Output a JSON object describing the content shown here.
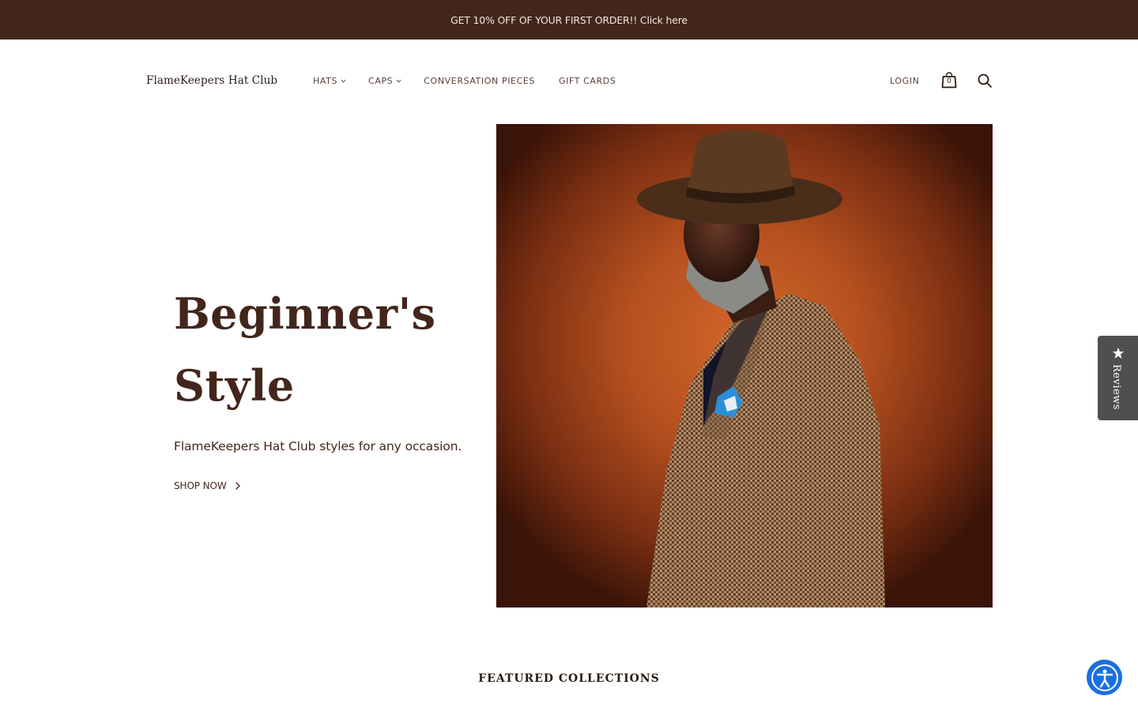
{
  "announcement": {
    "text": "GET 10% OFF OF YOUR FIRST ORDER!! Click here"
  },
  "header": {
    "logo": "FlameKeepers Hat Club",
    "nav": [
      {
        "label": "HATS",
        "has_dropdown": true
      },
      {
        "label": "CAPS",
        "has_dropdown": true
      },
      {
        "label": "CONVERSATION PIECES",
        "has_dropdown": false
      },
      {
        "label": "GIFT CARDS",
        "has_dropdown": false
      }
    ],
    "login": "LOGIN",
    "cart_count": "0"
  },
  "hero": {
    "title_line1": "Beginner's",
    "title_line2": "Style",
    "subtitle": "FlameKeepers Hat Club styles for any occasion.",
    "cta": "SHOP NOW"
  },
  "reviews_tab": {
    "label": "Reviews"
  },
  "featured": {
    "title": "FEATURED COLLECTIONS"
  },
  "colors": {
    "brand_brown": "#43261b",
    "a11y_blue": "#1a6fe0",
    "reviews_gray": "#4f4f4f"
  },
  "icons": {
    "cart": "shopping-bag-icon",
    "search": "search-icon",
    "chevron": "chevron-down-icon",
    "arrow": "chevron-right-icon",
    "star": "star-icon",
    "accessibility": "accessibility-icon"
  }
}
